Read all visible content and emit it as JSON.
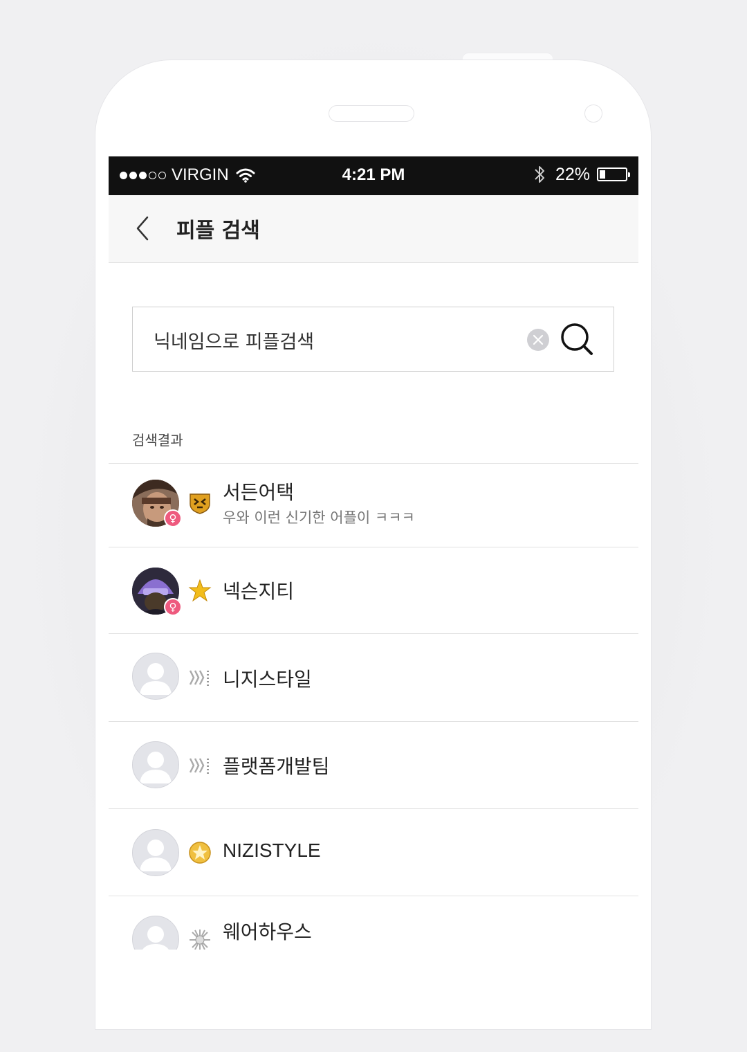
{
  "status_bar": {
    "carrier": "VIRGIN",
    "time": "4:21 PM",
    "battery": "22%",
    "battery_level": 0.22
  },
  "header": {
    "title": "피플 검색"
  },
  "search": {
    "value": "닉네임으로 피플검색"
  },
  "results_label": "검색결과",
  "results": [
    {
      "name": "서든어택",
      "status": "우와 이런 신기한 어플이 ㅋㅋㅋ",
      "avatar": "soldier-avatar",
      "gender": "female-icon",
      "badge": "shield-badge-icon"
    },
    {
      "name": "넥슨지티",
      "status": "",
      "avatar": "masked-character-avatar",
      "gender": "female-icon",
      "badge": "gold-star-icon"
    },
    {
      "name": "니지스타일",
      "status": "",
      "avatar": "default-avatar",
      "badge": "diamond-rank-icon"
    },
    {
      "name": "플랫폼개발팀",
      "status": "",
      "avatar": "default-avatar",
      "badge": "diamond-rank-icon"
    },
    {
      "name": "NIZISTYLE",
      "status": "",
      "avatar": "default-avatar",
      "badge": "star-medal-icon"
    },
    {
      "name": "웨어하우스",
      "status": "",
      "avatar": "default-avatar",
      "badge": "silver-burst-icon"
    }
  ],
  "colors": {
    "status_bar": "#111111",
    "gender_badge": "#ee5a7e",
    "nav_background": "#f7f7f7"
  }
}
